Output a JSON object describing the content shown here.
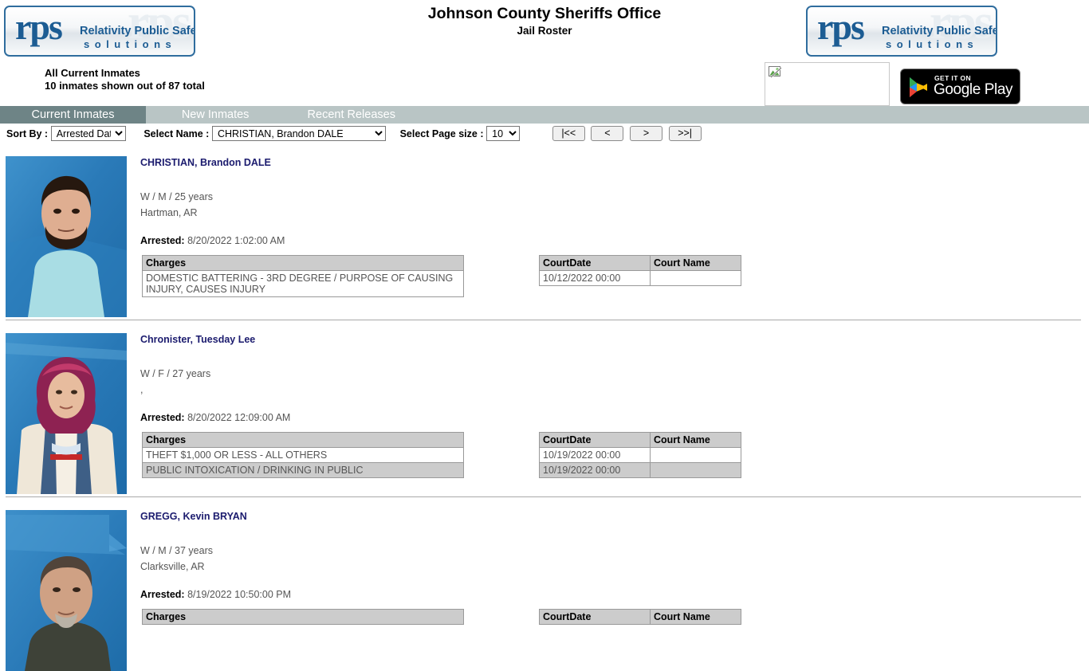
{
  "header": {
    "title": "Johnson County Sheriffs Office",
    "subtitle": "Jail Roster",
    "summary_line1": "All Current Inmates",
    "summary_line2": "10 inmates shown out of 87 total",
    "logo": {
      "mark": "rps",
      "ghost": "rps",
      "line1": "Relativity Public Safety",
      "line2": "solutions"
    },
    "google_play": {
      "small_text": "GET IT ON",
      "big_text": "Google Play"
    }
  },
  "tabs": [
    {
      "label": "Current Inmates",
      "active": true
    },
    {
      "label": "New Inmates",
      "active": false
    },
    {
      "label": "Recent Releases",
      "active": false
    }
  ],
  "controls": {
    "sort_label": "Sort By :",
    "sort_value": "Arrested Date",
    "name_label": "Select Name :",
    "name_value": "CHRISTIAN, Brandon DALE",
    "pagesize_label": "Select Page size :",
    "pagesize_value": "10",
    "buttons": {
      "first": "|<<",
      "prev": "<",
      "next": ">",
      "last": ">>|"
    }
  },
  "table_headers": {
    "charges": "Charges",
    "court_date": "CourtDate",
    "court_name": "Court Name"
  },
  "labels": {
    "arrested": "Arrested:"
  },
  "inmates": [
    {
      "name": "CHRISTIAN, Brandon DALE",
      "demographics": "W / M / 25 years",
      "location": "Hartman, AR",
      "arrested": "8/20/2022 1:02:00 AM",
      "charges": [
        "DOMESTIC BATTERING - 3RD DEGREE / PURPOSE OF CAUSING INJURY, CAUSES INJURY"
      ],
      "courts": [
        {
          "date": "10/12/2022 00:00",
          "name": ""
        }
      ]
    },
    {
      "name": "Chronister, Tuesday Lee",
      "demographics": "W / F / 27 years",
      "location": ",",
      "arrested": "8/20/2022 12:09:00 AM",
      "charges": [
        "THEFT $1,000 OR LESS - ALL OTHERS",
        "PUBLIC INTOXICATION / DRINKING IN PUBLIC"
      ],
      "courts": [
        {
          "date": "10/19/2022 00:00",
          "name": ""
        },
        {
          "date": "10/19/2022 00:00",
          "name": ""
        }
      ]
    },
    {
      "name": "GREGG, Kevin BRYAN",
      "demographics": "W / M / 37 years",
      "location": "Clarksville, AR",
      "arrested": "8/19/2022 10:50:00 PM",
      "charges": [],
      "courts": []
    }
  ],
  "colors": {
    "tabbar_bg": "#b9c5c5",
    "tab_active_bg": "#6e8486",
    "table_header_bg": "#cccccc",
    "name_link": "#1b1b6e",
    "logo_blue": "#1c5c93"
  }
}
